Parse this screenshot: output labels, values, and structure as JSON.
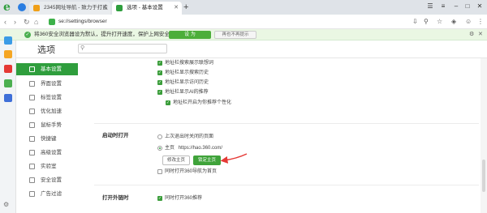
{
  "tabs": [
    {
      "title": "2345网址导航 - 致力于打造",
      "active": false
    },
    {
      "title": "选项 - 基本设置",
      "active": true
    }
  ],
  "address": {
    "url": "se://settings/browser"
  },
  "notification": {
    "text": "将360安全浏览器设为默认，提升打开速度，保护上网安全",
    "set_default": "设 为",
    "no_prompt": "再也不再提示"
  },
  "settings": {
    "title": "选项",
    "search_placeholder": "",
    "nav": [
      {
        "label": "基本设置",
        "icon": "gear-icon",
        "active": true
      },
      {
        "label": "界面设置",
        "icon": "layout-icon"
      },
      {
        "label": "标签设置",
        "icon": "tab-icon"
      },
      {
        "label": "优化加速",
        "icon": "rocket-icon"
      },
      {
        "label": "鼠标手势",
        "icon": "mouse-icon"
      },
      {
        "label": "快捷键",
        "icon": "keyboard-icon"
      },
      {
        "label": "高级设置",
        "icon": "advanced-icon"
      },
      {
        "label": "实验室",
        "icon": "flask-icon"
      },
      {
        "label": "安全设置",
        "icon": "shield-icon"
      },
      {
        "label": "广告过滤",
        "icon": "filter-icon"
      }
    ],
    "address_options": [
      {
        "label": "地址栏搜索展示联想词",
        "checked": true
      },
      {
        "label": "地址栏显示搜索历史",
        "checked": true
      },
      {
        "label": "地址栏显示访问历史",
        "checked": true
      },
      {
        "label": "地址栏显示AI的推荐",
        "checked": true
      },
      {
        "label": "地址栏开启为你推荐个性化",
        "checked": true
      }
    ],
    "startup": {
      "section_label": "启动时打开",
      "option_last": "上次退出时关闭的页面",
      "option_home_prefix": "主页",
      "home_url": "https://hao.360.com/",
      "edit_button": "修改主页",
      "lock_button": "锁定主页",
      "also_open": "同时打开360导航为首页"
    },
    "download": {
      "section_label": "打开外链时",
      "option": "同时打开360推荐"
    }
  },
  "colors": {
    "accent": "#2f9e3d",
    "arrow": "#e53935"
  }
}
